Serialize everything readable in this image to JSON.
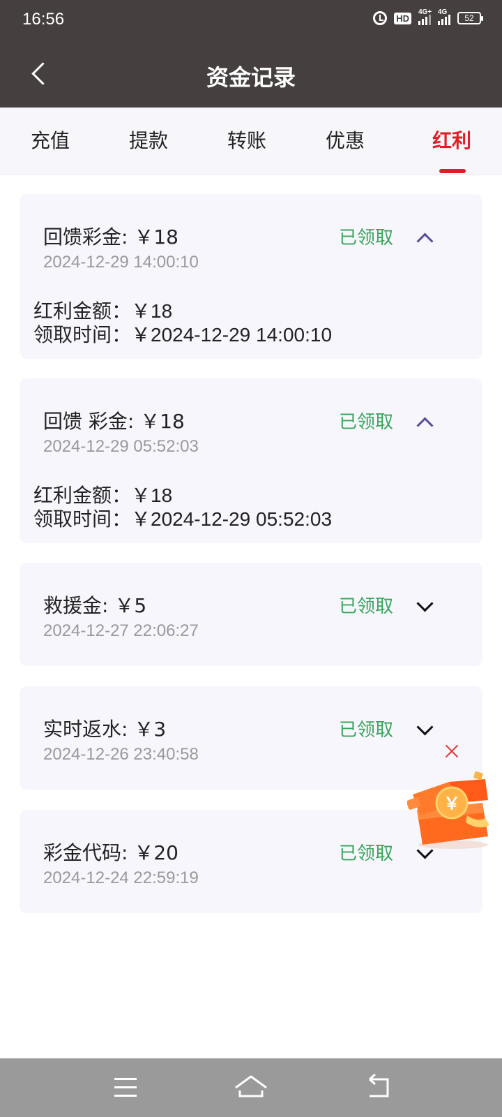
{
  "status_bar": {
    "time": "16:56",
    "hd_label": "HD",
    "signal_1_label": "4G+",
    "signal_2_label": "4G",
    "battery": "52"
  },
  "header": {
    "title": "资金记录"
  },
  "tabs": [
    {
      "label": "充值",
      "active": false
    },
    {
      "label": "提款",
      "active": false
    },
    {
      "label": "转账",
      "active": false
    },
    {
      "label": "优惠",
      "active": false
    },
    {
      "label": "红利",
      "active": true
    }
  ],
  "records": [
    {
      "title": "回馈彩金: ￥18",
      "date": "2024-12-29 14:00:10",
      "status": "已领取",
      "expanded": true,
      "amount_label": "红利金额：",
      "amount_value": "￥18",
      "time_label": "领取时间：",
      "time_value": "￥2024-12-29 14:00:10"
    },
    {
      "title": "回馈 彩金: ￥18",
      "date": "2024-12-29 05:52:03",
      "status": "已领取",
      "expanded": true,
      "amount_label": "红利金额：",
      "amount_value": "￥18",
      "time_label": "领取时间：",
      "time_value": "￥2024-12-29 05:52:03"
    },
    {
      "title": "救援金: ￥5",
      "date": "2024-12-27 22:06:27",
      "status": "已领取",
      "expanded": false
    },
    {
      "title": "实时返水: ￥3",
      "date": "2024-12-26 23:40:58",
      "status": "已领取",
      "expanded": false
    },
    {
      "title": "彩金代码: ￥20",
      "date": "2024-12-24 22:59:19",
      "status": "已领取",
      "expanded": false
    }
  ],
  "floating_promo": {
    "icon": "gift-box-icon",
    "coin_symbol": "￥",
    "close_icon": "close-icon"
  },
  "colors": {
    "header_bg": "#463f3f",
    "active_tab": "#e01e26",
    "status_green": "#3ba55c",
    "card_bg": "#f6f6fc"
  }
}
